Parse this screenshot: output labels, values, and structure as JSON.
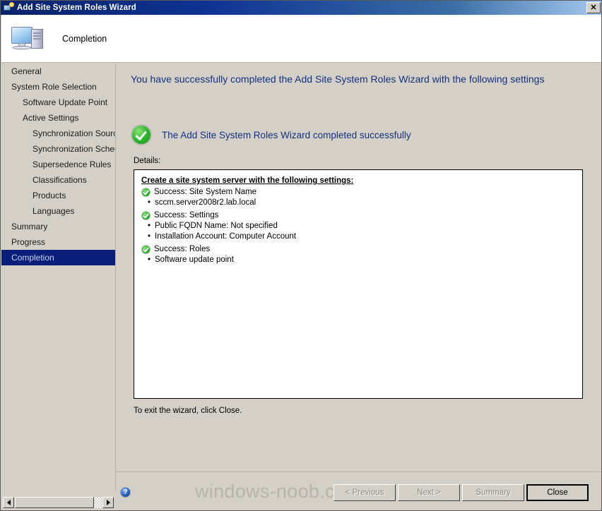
{
  "window": {
    "title": "Add Site System Roles Wizard",
    "icon": "wizard-icon",
    "close_label": "✕"
  },
  "header": {
    "icon": "computer-icon",
    "title": "Completion"
  },
  "sidebar": {
    "items": [
      {
        "label": "General",
        "level": 0,
        "selected": false
      },
      {
        "label": "System Role Selection",
        "level": 0,
        "selected": false
      },
      {
        "label": "Software Update Point",
        "level": 1,
        "selected": false
      },
      {
        "label": "Active Settings",
        "level": 1,
        "selected": false
      },
      {
        "label": "Synchronization Source",
        "level": 2,
        "selected": false
      },
      {
        "label": "Synchronization Schedule",
        "level": 2,
        "selected": false
      },
      {
        "label": "Supersedence Rules",
        "level": 2,
        "selected": false
      },
      {
        "label": "Classifications",
        "level": 2,
        "selected": false
      },
      {
        "label": "Products",
        "level": 2,
        "selected": false
      },
      {
        "label": "Languages",
        "level": 2,
        "selected": false
      },
      {
        "label": "Summary",
        "level": 0,
        "selected": false
      },
      {
        "label": "Progress",
        "level": 0,
        "selected": false
      },
      {
        "label": "Completion",
        "level": 0,
        "selected": true
      }
    ],
    "selected_color": "#0a1f7a"
  },
  "scrollbar": {
    "left_arrow": "scroll-left-icon",
    "right_arrow": "scroll-right-icon"
  },
  "main": {
    "heading": "You have successfully completed the Add Site System Roles Wizard with the following settings",
    "result_icon": "success-check-icon",
    "result_text": "The Add Site System Roles Wizard completed successfully",
    "details_label": "Details:",
    "details": {
      "title": "Create a site system server with the following settings:",
      "groups": [
        {
          "status_icon": "success-check-icon",
          "heading": "Success: Site System Name",
          "bullets": [
            "sccm.server2008r2.lab.local"
          ]
        },
        {
          "status_icon": "success-check-icon",
          "heading": "Success: Settings",
          "bullets": [
            "Public FQDN Name: Not specified",
            "Installation Account: Computer Account"
          ]
        },
        {
          "status_icon": "success-check-icon",
          "heading": "Success: Roles",
          "bullets": [
            "Software update point"
          ]
        }
      ]
    },
    "exit_note": "To exit the wizard, click Close.",
    "heading_color": "#13317d",
    "success_color": "#2eb82e"
  },
  "footer": {
    "help_icon": "help-icon",
    "help_glyph": "?",
    "watermark": "windows-noob.com",
    "buttons": {
      "previous": "< Previous",
      "next": "Next >",
      "summary": "Summary",
      "close": "Close"
    }
  }
}
